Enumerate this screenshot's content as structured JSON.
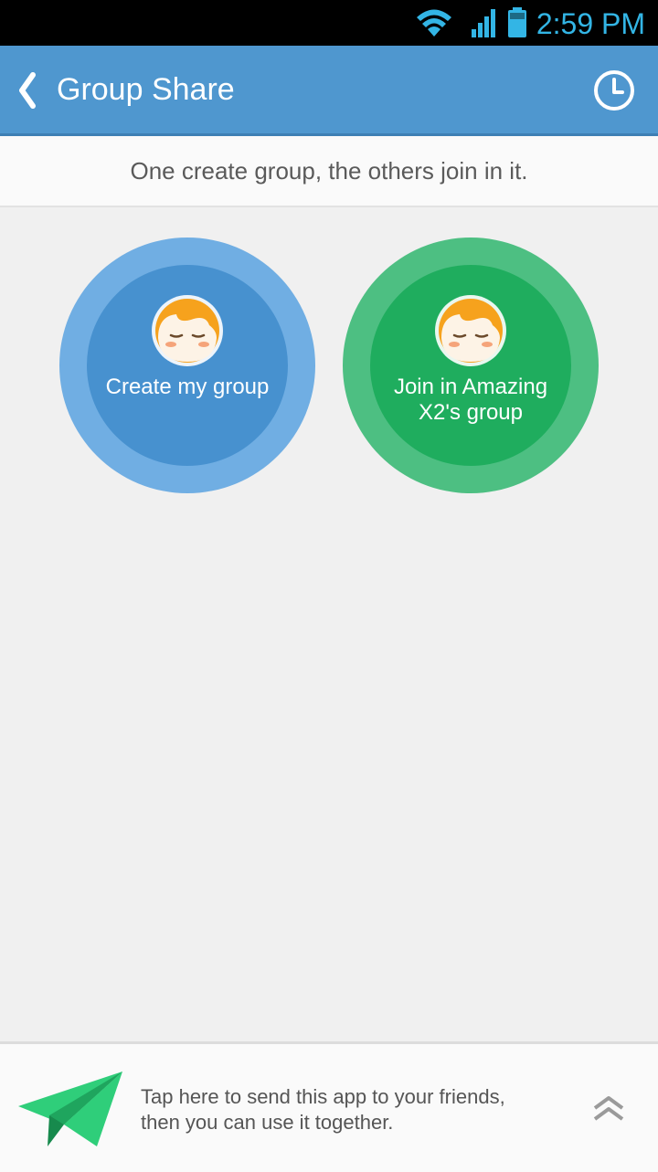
{
  "status_bar": {
    "time": "2:59 PM",
    "icons": [
      "wifi-icon",
      "signal-icon",
      "battery-icon"
    ],
    "accent_color": "#33b5e5"
  },
  "app_bar": {
    "back_icon": "chevron-left-icon",
    "title": "Group Share",
    "history_icon": "clock-icon",
    "background": "#4f97cf"
  },
  "subtitle": "One create group, the others join in it.",
  "actions": {
    "create": {
      "label": "Create my group",
      "avatar_icon": "smiley-face-avatar-icon",
      "outer_color": "#70aee3",
      "inner_color": "#4791cf"
    },
    "join": {
      "label_line1": "Join in Amazing",
      "label_line2": "X2's group",
      "avatar_icon": "smiley-face-avatar-icon",
      "outer_color": "#4dbf82",
      "inner_color": "#1fad5e"
    }
  },
  "share_bar": {
    "icon": "paper-plane-icon",
    "line1": "Tap here to send this app to your friends,",
    "line2": "then you can use it together.",
    "expand_icon": "double-chevron-up-icon"
  }
}
